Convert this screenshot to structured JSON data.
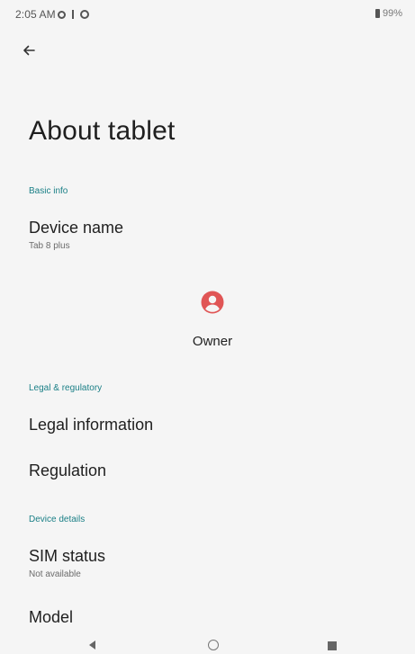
{
  "status_bar": {
    "time": "2:05 AM",
    "battery": "99%"
  },
  "header": {
    "title": "About tablet"
  },
  "sections": {
    "basic_info": {
      "header": "Basic info",
      "device_name": {
        "title": "Device name",
        "subtitle": "Tab 8 plus"
      },
      "owner": {
        "label": "Owner"
      }
    },
    "legal": {
      "header": "Legal & regulatory",
      "legal_information": {
        "title": "Legal information"
      },
      "regulation": {
        "title": "Regulation"
      }
    },
    "device_details": {
      "header": "Device details",
      "sim_status": {
        "title": "SIM status",
        "subtitle": "Not available"
      },
      "model": {
        "title": "Model"
      }
    }
  },
  "colors": {
    "accent": "#1a7f86",
    "owner_icon": "#e05555",
    "background": "#f5f5f5"
  },
  "icons": {
    "back": "arrow-left-icon",
    "owner": "account-circle-icon"
  }
}
